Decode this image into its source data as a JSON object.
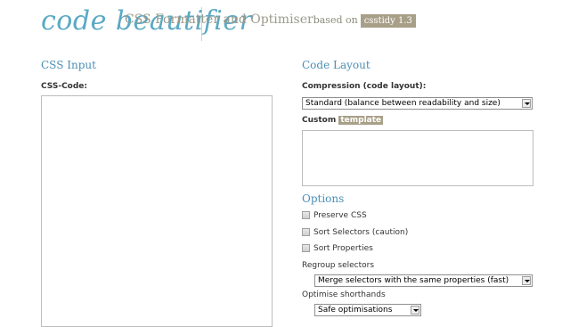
{
  "header": {
    "logo_text": "code beautifier",
    "title": "CSS Formatter and Optimiser",
    "based_on": "based on",
    "badge": "csstidy 1.3"
  },
  "input_section": {
    "heading": "CSS Input",
    "code_label": "CSS-Code:"
  },
  "layout_section": {
    "heading": "Code Layout",
    "compression_label": "Compression (code layout):",
    "compression_value": "Standard (balance between readability and size)",
    "custom_label": "Custom",
    "template_badge": "template"
  },
  "options_section": {
    "heading": "Options",
    "checkboxes": [
      {
        "label": "Preserve CSS",
        "checked": false
      },
      {
        "label": "Sort Selectors (caution)",
        "checked": false
      },
      {
        "label": "Sort Properties",
        "checked": false
      }
    ],
    "regroup_label": "Regroup selectors",
    "regroup_value": "Merge selectors with the same properties (fast)",
    "shorthands_label": "Optimise shorthands",
    "shorthands_value": "Safe optimisations"
  }
}
